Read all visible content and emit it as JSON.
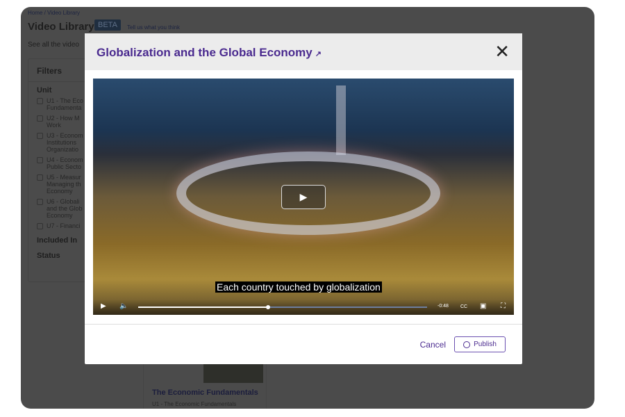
{
  "background": {
    "breadcrumb": "Home / Video Library",
    "title": "Video Library",
    "beta": "BETA",
    "feedback": "Tell us what you think",
    "see_all": "See all the video",
    "filters": {
      "title": "Filters",
      "unit_label": "Unit",
      "units": [
        "U1 - The Eco\nFundamenta",
        "U2 - How M\nWork",
        "U3 - Econom\nInstitutions\nOrganizatio",
        "U4 - Econom\nPublic Secto",
        "U5 - Measur\nManaging th\nEconomy",
        "U6 - Globali\nand the Glob\nEconomy",
        "U7 - Financi"
      ],
      "included_in": "Included In",
      "status": "Status"
    },
    "card": {
      "title": "The Economic Fundamentals",
      "subtitle": "U1 - The Economic Fundamentals"
    }
  },
  "modal": {
    "title": "Globalization and the Global Economy",
    "external_icon": "external-link-icon",
    "close_icon": "close-icon",
    "video": {
      "caption": "Each country touched by globalization",
      "time_remaining": "-0:48",
      "progress": 0.45
    },
    "cancel": "Cancel",
    "publish": "Publish"
  },
  "colors": {
    "accent": "#4a2a8f",
    "overlay": "#4b4b4b"
  }
}
